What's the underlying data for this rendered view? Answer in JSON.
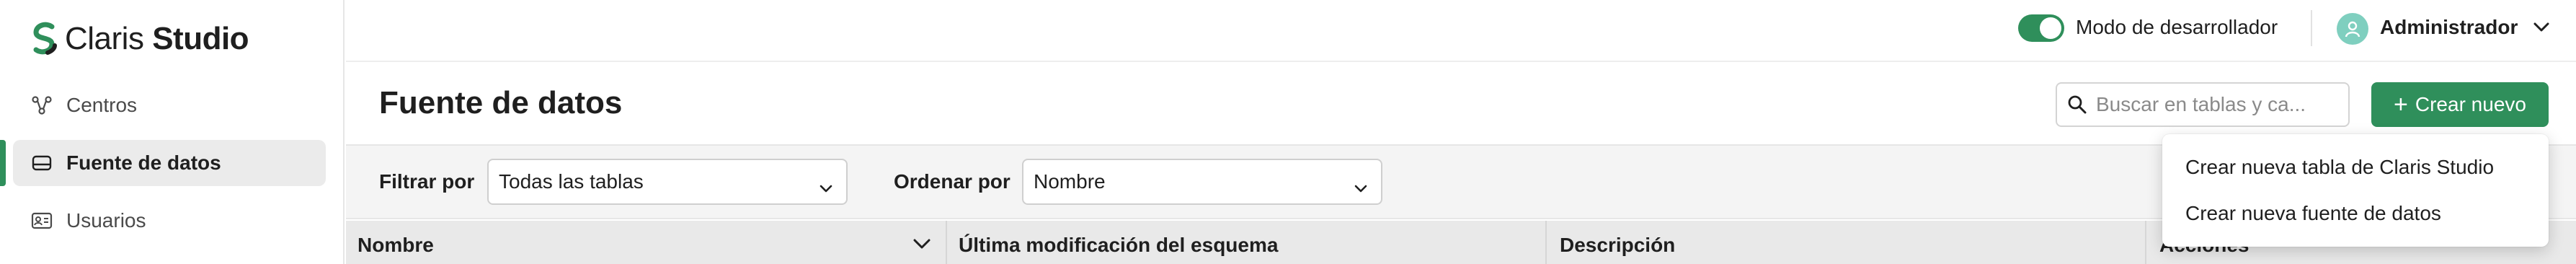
{
  "app": {
    "logo_text_regular": "Claris",
    "logo_text_bold": "Studio",
    "brand_color": "#2f8f5b"
  },
  "sidebar": {
    "items": [
      {
        "label": "Centros",
        "icon": "hubs-icon",
        "active": false
      },
      {
        "label": "Fuente de datos",
        "icon": "database-icon",
        "active": true
      },
      {
        "label": "Usuarios",
        "icon": "user-card-icon",
        "active": false
      }
    ]
  },
  "topbar": {
    "dev_mode_label": "Modo de desarrollador",
    "dev_mode_on": true,
    "user_name": "Administrador"
  },
  "header": {
    "title": "Fuente de datos",
    "search_placeholder": "Buscar en tablas y ca...",
    "create_button_label": "Crear nuevo"
  },
  "filters": {
    "filter_label": "Filtrar por",
    "filter_value": "Todas las tablas",
    "sort_label": "Ordenar por",
    "sort_value": "Nombre"
  },
  "table": {
    "columns": [
      "Nombre",
      "Última modificación del esquema",
      "Descripción",
      "Acciones"
    ]
  },
  "create_menu": {
    "items": [
      "Crear nueva tabla de Claris Studio",
      "Crear nueva fuente de datos"
    ]
  }
}
